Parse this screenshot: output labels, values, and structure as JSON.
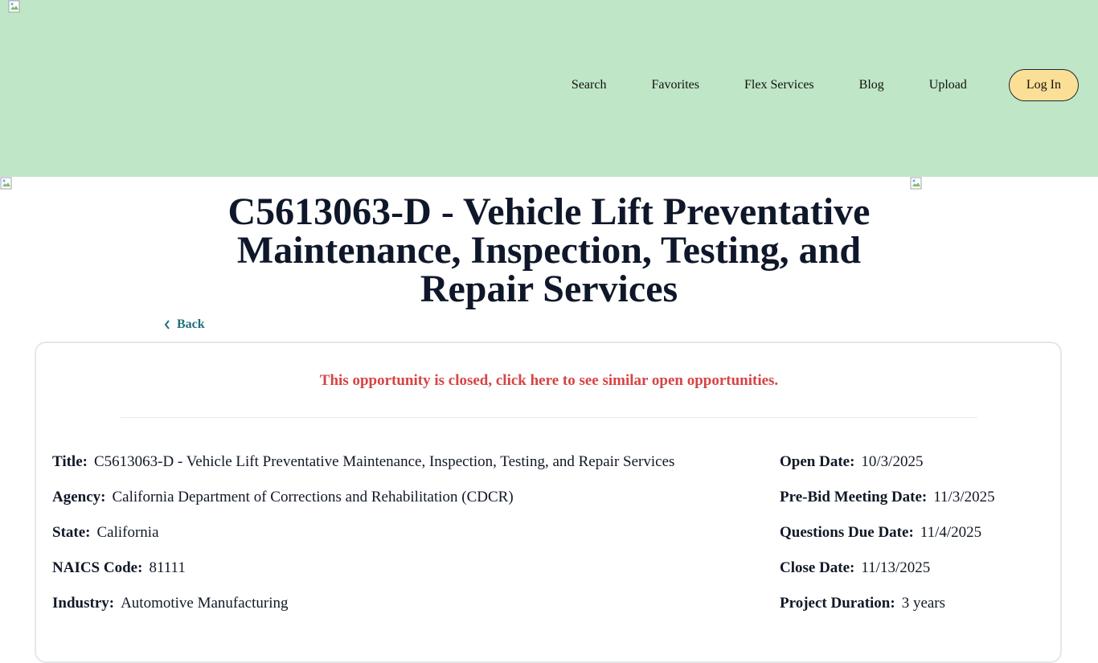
{
  "nav": {
    "items": [
      "Search",
      "Favorites",
      "Flex Services",
      "Blog",
      "Upload"
    ],
    "login_label": "Log In"
  },
  "page": {
    "title": "C5613063-D - Vehicle Lift Preventative Maintenance, Inspection, Testing, and Repair Services",
    "back_label": "Back",
    "closed_message": "This opportunity is closed, click here to see similar open opportunities."
  },
  "details_left": [
    {
      "label": "Title:",
      "value": "C5613063-D - Vehicle Lift Preventative Maintenance, Inspection, Testing, and Repair Services"
    },
    {
      "label": "Agency:",
      "value": "California Department of Corrections and Rehabilitation (CDCR)"
    },
    {
      "label": "State:",
      "value": "California"
    },
    {
      "label": "NAICS Code:",
      "value": "81111"
    },
    {
      "label": "Industry:",
      "value": "Automotive Manufacturing"
    }
  ],
  "details_right": [
    {
      "label": "Open Date:",
      "value": "10/3/2025"
    },
    {
      "label": "Pre-Bid Meeting Date:",
      "value": "11/3/2025"
    },
    {
      "label": "Questions Due Date:",
      "value": "11/4/2025"
    },
    {
      "label": "Close Date:",
      "value": "11/13/2025"
    },
    {
      "label": "Project Duration:",
      "value": "3 years"
    }
  ],
  "colors": {
    "header_bg": "#bfe6c6",
    "login_bg": "#fcdf96",
    "closed_text": "#d74444",
    "back_link": "#1e6f7a"
  },
  "icons": [
    "broken-image-icon",
    "chevron-left-icon"
  ]
}
